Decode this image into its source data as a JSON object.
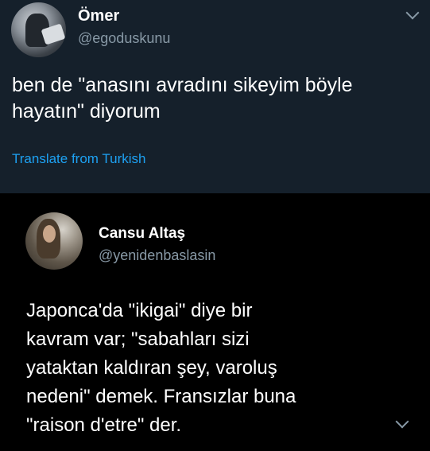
{
  "tweet": {
    "author_name": "Ömer",
    "author_handle": "@egoduskunu",
    "text_lines": [
      "ben de \"anasını avradını sikeyim böyle",
      "hayatın\" diyorum"
    ],
    "translate_link": "Translate from Turkish",
    "menu_icon": "chevron-down-icon"
  },
  "quoted_tweet": {
    "author_name": "Cansu Altaş",
    "author_handle": "@yenidenbaslasin",
    "text_lines": [
      "Japonca'da \"ikigai\" diye bir",
      "kavram var; \"sabahları sizi",
      "yataktan kaldıran şey, varoluş",
      "nedeni\" demek. Fransızlar buna",
      "\"raison d'etre\" der."
    ],
    "menu_icon": "chevron-down-icon"
  },
  "colors": {
    "background": "#15202b",
    "quote_background": "#000000",
    "link": "#1da1f2",
    "secondary_text": "#8899a6"
  }
}
